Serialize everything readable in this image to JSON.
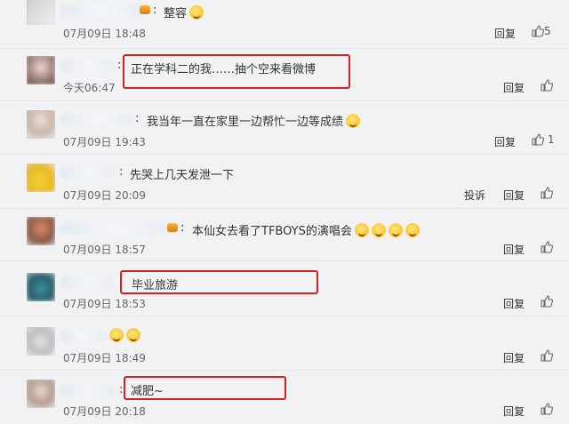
{
  "comments": [
    {
      "text": "整容",
      "time": "07月09日 18:48",
      "reply": "回复",
      "likes": "5"
    },
    {
      "text": "正在学科二的我……抽个空来看微博",
      "time": "今天06:47",
      "reply": "回复",
      "likes": ""
    },
    {
      "text": "我当年一直在家里一边帮忙一边等成绩",
      "time": "07月09日 19:43",
      "reply": "回复",
      "likes": "1"
    },
    {
      "text": "先哭上几天发泄一下",
      "time": "07月09日 20:09",
      "reply": "回复",
      "report": "投诉",
      "likes": ""
    },
    {
      "text": "本仙女去看了TFBOYS的演唱会",
      "time": "07月09日 18:57",
      "reply": "回复",
      "likes": ""
    },
    {
      "text": "毕业旅游",
      "time": "07月09日 18:53",
      "reply": "回复",
      "likes": ""
    },
    {
      "text": "",
      "time": "07月09日 18:49",
      "reply": "回复",
      "likes": ""
    },
    {
      "text": "减肥~",
      "time": "07月09日 20:18",
      "reply": "回复",
      "likes": ""
    }
  ],
  "colors": {
    "highlight": "#d62021",
    "background": "#f2f2f5"
  },
  "icons": {
    "like": "thumbs-up-icon",
    "emoji": "emoji-icon"
  }
}
